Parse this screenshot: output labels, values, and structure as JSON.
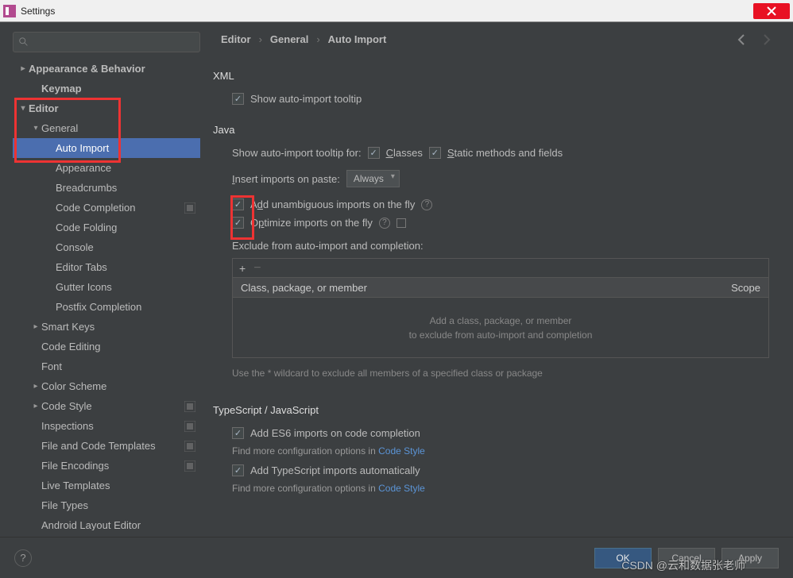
{
  "window": {
    "title": "Settings"
  },
  "search": {
    "placeholder": ""
  },
  "breadcrumb": [
    "Editor",
    "General",
    "Auto Import"
  ],
  "sidebar": [
    {
      "label": "Appearance & Behavior",
      "indent": 0,
      "chev": "closed",
      "bold": true
    },
    {
      "label": "Keymap",
      "indent": 1,
      "chev": "none",
      "bold": true
    },
    {
      "label": "Editor",
      "indent": 0,
      "chev": "open",
      "bold": true
    },
    {
      "label": "General",
      "indent": 1,
      "chev": "open",
      "bold": false
    },
    {
      "label": "Auto Import",
      "indent": 2,
      "chev": "none",
      "bold": false,
      "selected": true
    },
    {
      "label": "Appearance",
      "indent": 2,
      "chev": "none"
    },
    {
      "label": "Breadcrumbs",
      "indent": 2,
      "chev": "none"
    },
    {
      "label": "Code Completion",
      "indent": 2,
      "chev": "none",
      "badge": true
    },
    {
      "label": "Code Folding",
      "indent": 2,
      "chev": "none"
    },
    {
      "label": "Console",
      "indent": 2,
      "chev": "none"
    },
    {
      "label": "Editor Tabs",
      "indent": 2,
      "chev": "none"
    },
    {
      "label": "Gutter Icons",
      "indent": 2,
      "chev": "none"
    },
    {
      "label": "Postfix Completion",
      "indent": 2,
      "chev": "none"
    },
    {
      "label": "Smart Keys",
      "indent": 1,
      "chev": "closed"
    },
    {
      "label": "Code Editing",
      "indent": 1,
      "chev": "none"
    },
    {
      "label": "Font",
      "indent": 1,
      "chev": "none"
    },
    {
      "label": "Color Scheme",
      "indent": 1,
      "chev": "closed"
    },
    {
      "label": "Code Style",
      "indent": 1,
      "chev": "closed",
      "badge": true
    },
    {
      "label": "Inspections",
      "indent": 1,
      "chev": "none",
      "badge": true
    },
    {
      "label": "File and Code Templates",
      "indent": 1,
      "chev": "none",
      "badge": true
    },
    {
      "label": "File Encodings",
      "indent": 1,
      "chev": "none",
      "badge": true
    },
    {
      "label": "Live Templates",
      "indent": 1,
      "chev": "none"
    },
    {
      "label": "File Types",
      "indent": 1,
      "chev": "none"
    },
    {
      "label": "Android Layout Editor",
      "indent": 1,
      "chev": "none"
    }
  ],
  "xml": {
    "title": "XML",
    "show_tooltip": "Show auto-import tooltip"
  },
  "java": {
    "title": "Java",
    "show_tooltip_for": "Show auto-import tooltip for:",
    "classes": "Classes",
    "static": "Static methods and fields",
    "insert_label": "Insert imports on paste:",
    "insert_value": "Always",
    "add_unambiguous": "Add unambiguous imports on the fly",
    "optimize": "Optimize imports on the fly",
    "exclude_label": "Exclude from auto-import and completion:",
    "col_class": "Class, package, or member",
    "col_scope": "Scope",
    "empty1": "Add a class, package, or member",
    "empty2": "to exclude from auto-import and completion",
    "hint": "Use the * wildcard to exclude all members of a specified class or package"
  },
  "ts": {
    "title": "TypeScript / JavaScript",
    "add_es6": "Add ES6 imports on code completion",
    "more1a": "Find more configuration options in ",
    "more1b": "Code Style",
    "add_ts": "Add TypeScript imports automatically",
    "more2a": "Find more configuration options in ",
    "more2b": "Code Style"
  },
  "footer": {
    "ok": "OK",
    "cancel": "Cancel",
    "apply": "Apply"
  },
  "watermark": "CSDN @云和数据张老师"
}
